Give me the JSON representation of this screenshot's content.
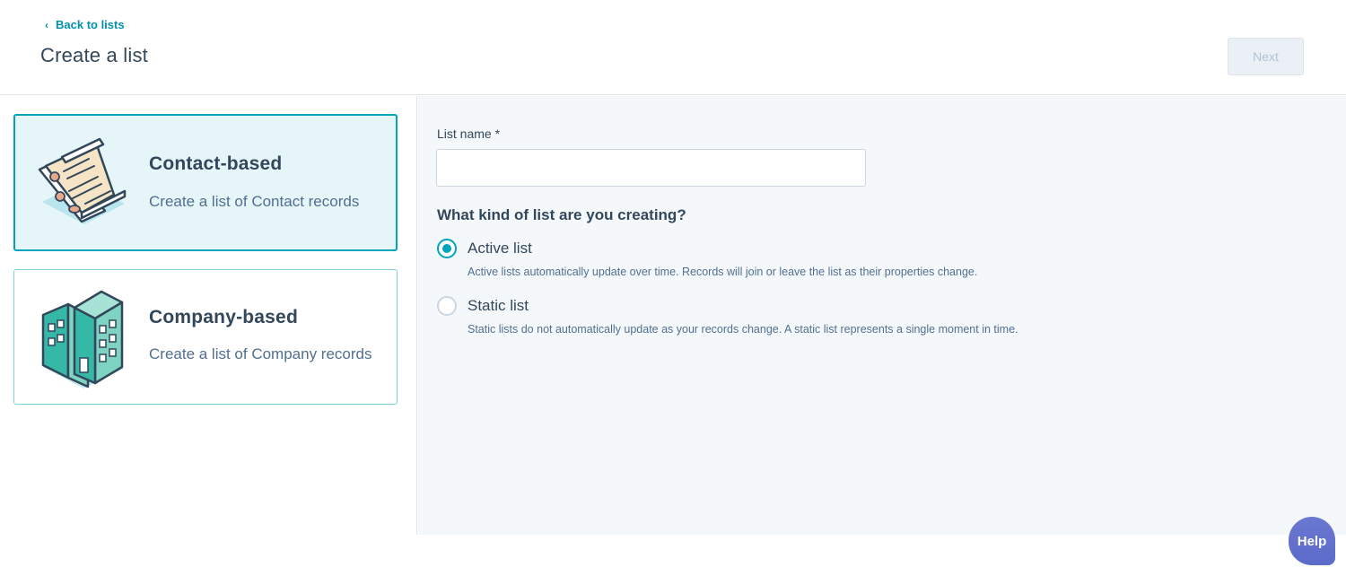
{
  "header": {
    "back_label": "Back to lists",
    "title": "Create a list",
    "next_label": "Next"
  },
  "cards": [
    {
      "title": "Contact-based",
      "description": "Create a list of Contact records",
      "selected": true,
      "icon": "contact-cards-icon"
    },
    {
      "title": "Company-based",
      "description": "Create a list of Company records",
      "selected": false,
      "icon": "building-icon"
    }
  ],
  "form": {
    "list_name_label": "List name *",
    "list_name_value": "",
    "list_name_placeholder": "",
    "question": "What kind of list are you creating?",
    "options": [
      {
        "label": "Active list",
        "help": "Active lists automatically update over time. Records will join or leave the list as their properties change.",
        "checked": true
      },
      {
        "label": "Static list",
        "help": "Static lists do not automatically update as your records change. A static list represents a single moment in time.",
        "checked": false
      }
    ]
  },
  "help_label": "Help",
  "colors": {
    "accent": "#00a4bd",
    "link": "#0091ae",
    "text": "#33475b",
    "selected_bg": "#e5f5f8",
    "panel_bg": "#f5f8fa"
  }
}
